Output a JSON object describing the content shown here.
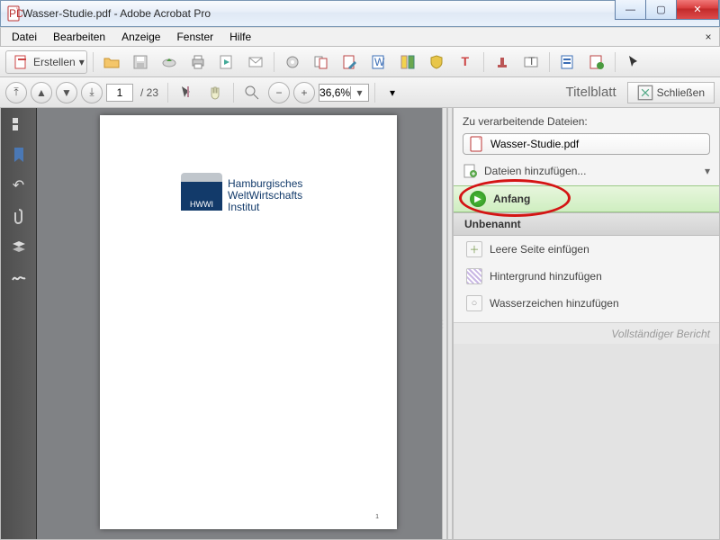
{
  "window": {
    "title": "Wasser-Studie.pdf - Adobe Acrobat Pro",
    "doc_icon": "pdf"
  },
  "menubar": {
    "items": [
      "Datei",
      "Bearbeiten",
      "Anzeige",
      "Fenster",
      "Hilfe"
    ]
  },
  "toolbar": {
    "create_label": "Erstellen"
  },
  "nav": {
    "page_current": "1",
    "page_total": "23",
    "zoom": "36,6%"
  },
  "panel": {
    "name": "Titelblatt",
    "close_label": "Schließen"
  },
  "document": {
    "logo_acronym": "HWWI",
    "logo_line1": "Hamburgisches",
    "logo_line2": "WeltWirtschafts",
    "logo_line3": "Institut",
    "page_number": "1"
  },
  "right": {
    "heading": "Zu verarbeitende Dateien:",
    "file_name": "Wasser-Studie.pdf",
    "add_files": "Dateien hinzufügen...",
    "start": "Anfang",
    "section": "Unbenannt",
    "actions": {
      "a0": "Leere Seite einfügen",
      "a1": "Hintergrund hinzufügen",
      "a2": "Wasserzeichen hinzufügen"
    },
    "footer": "Vollständiger Bericht"
  }
}
